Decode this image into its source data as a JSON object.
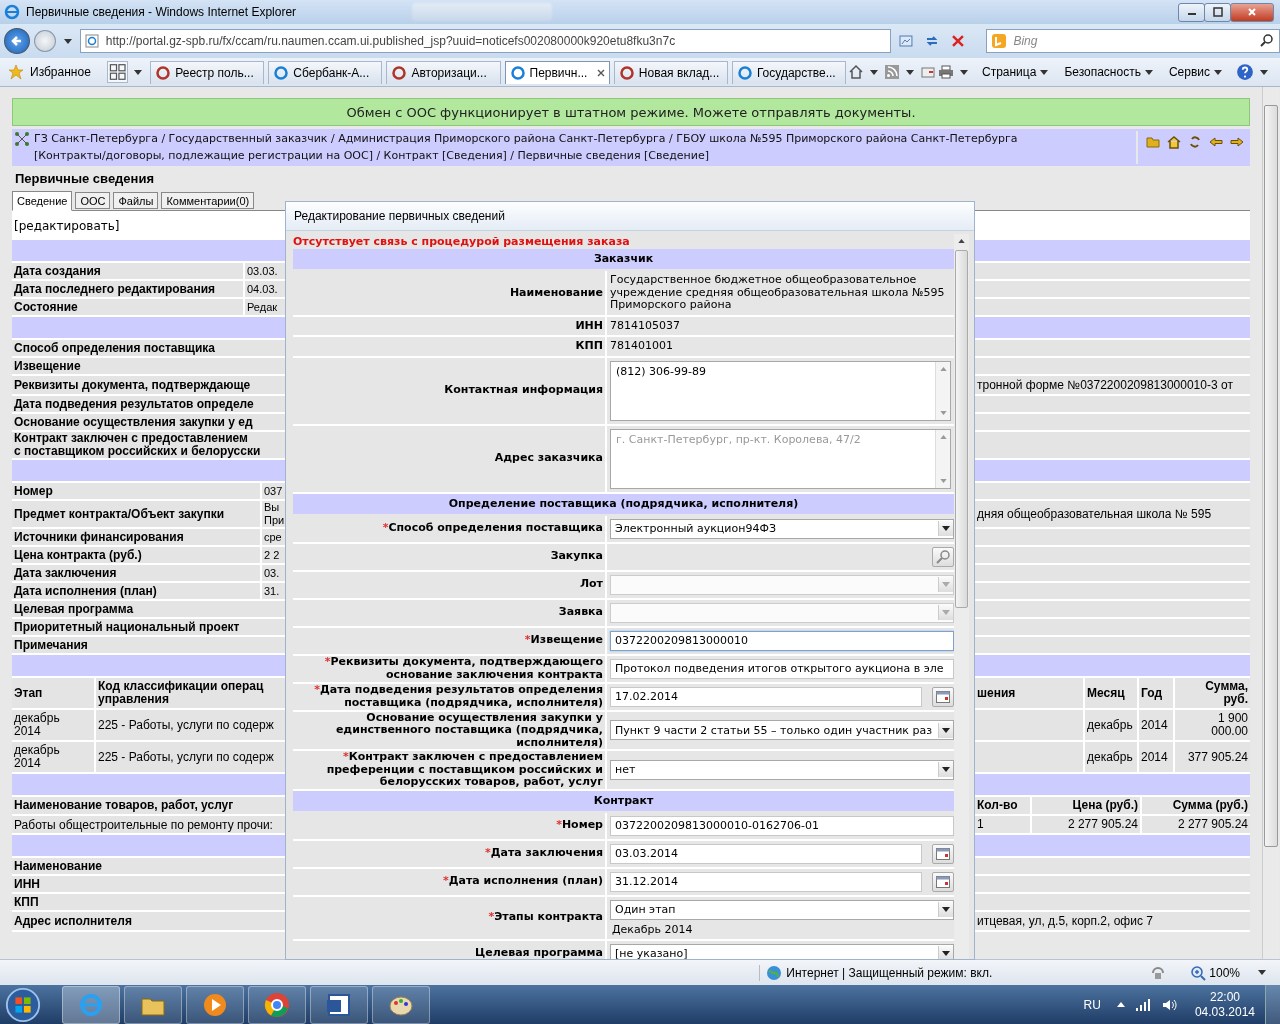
{
  "window": {
    "title": "Первичные сведения - Windows Internet Explorer"
  },
  "address_bar": {
    "url": "http://portal.gz-spb.ru/fx/ccam/ru.naumen.ccam.ui.published_jsp?uuid=noticefs002080000k920etu8fku3n7c",
    "search_placeholder": "Bing"
  },
  "favorites": {
    "label": "Избранное"
  },
  "browser_tabs": [
    {
      "label": "Реестр поль...",
      "selected": false
    },
    {
      "label": "Сбербанк-А...",
      "selected": false
    },
    {
      "label": "Авторизаци...",
      "selected": false
    },
    {
      "label": "Первичн...",
      "selected": true
    },
    {
      "label": "Новая вклад...",
      "selected": false
    },
    {
      "label": "Государстве...",
      "selected": false
    }
  ],
  "command_bar": [
    "Страница",
    "Безопасность",
    "Сервис"
  ],
  "page": {
    "banner": "Обмен с ООС функционирует в штатном режиме. Можете отправлять документы.",
    "breadcrumb": "ГЗ Санкт-Петербурга / Государственный заказчик / Администрация Приморского района Санкт-Петербурга / ГБОУ школа №595 Приморского района Санкт-Петербурга\n[Контракты/договоры, подлежащие регистрации на ООС] / Контракт [Сведения] / Первичные сведения [Сведение]",
    "title": "Первичные сведения",
    "tabs": [
      {
        "label": "Сведение",
        "selected": true
      },
      {
        "label": "ООС",
        "selected": false
      },
      {
        "label": "Файлы",
        "selected": false
      },
      {
        "label": "Комментарии(0)",
        "selected": false
      }
    ],
    "edit_link": "[редактировать]",
    "rows": [
      {
        "kind": "band"
      },
      {
        "kind": "field",
        "label": "Дата создания",
        "value": "03.03."
      },
      {
        "kind": "field",
        "label": "Дата последнего редактирования",
        "value": "04.03."
      },
      {
        "kind": "field",
        "label": "Состояние",
        "value": "Редак"
      },
      {
        "kind": "band"
      },
      {
        "kind": "field",
        "label": "Способ определения поставщика"
      },
      {
        "kind": "field",
        "label": "Извещение"
      },
      {
        "kind": "field",
        "label": "Реквизиты документа, подтверждающе",
        "right": "тронной форме №0372200209813000010-3 от"
      },
      {
        "kind": "field",
        "label": "Дата подведения результатов определе"
      },
      {
        "kind": "field",
        "label": "Основание осуществления закупки у ед"
      },
      {
        "kind": "field",
        "label": "Контракт заключен с предоставлением\nс поставщиком российских и белорусски"
      },
      {
        "kind": "band"
      },
      {
        "kind": "contract-field",
        "label": "Номер",
        "value": "037"
      },
      {
        "kind": "contract-field",
        "label": "Предмет контракта/Объект закупки",
        "value": "Вы\nПри",
        "right": "дняя общеобразовательная школа № 595"
      },
      {
        "kind": "contract-field",
        "label": "Источники финансирования",
        "value": "сре"
      },
      {
        "kind": "contract-field",
        "label": "Цена контракта (руб.)",
        "value": "2 2"
      },
      {
        "kind": "contract-field",
        "label": "Дата заключения",
        "value": "03."
      },
      {
        "kind": "contract-field",
        "label": "Дата исполнения (план)",
        "value": "31."
      },
      {
        "kind": "contract-field",
        "label": "Целевая программа"
      },
      {
        "kind": "contract-field",
        "label": "Приоритетный национальный проект"
      },
      {
        "kind": "contract-field",
        "label": "Примечания"
      },
      {
        "kind": "band"
      },
      {
        "kind": "stage-head",
        "stage": "Этап",
        "code": "Код классификации операц\nуправления",
        "tail": "шения",
        "month": "Месяц",
        "year": "Год",
        "sum": "Сумма,\nруб."
      },
      {
        "kind": "stage-row",
        "stage": "декабрь\n2014",
        "code": "225 - Работы, услуги по содерж",
        "month": "декабрь",
        "year": "2014",
        "sum": "1 900\n000.00"
      },
      {
        "kind": "stage-row",
        "stage": "декабрь\n2014",
        "code": "225 - Работы, услуги по содерж",
        "month": "декабрь",
        "year": "2014",
        "sum": "377 905.24"
      },
      {
        "kind": "band"
      },
      {
        "kind": "goods-head",
        "name": "Наименование товаров, работ, услуг",
        "qty": "Кол-во",
        "price": "Цена (руб.)",
        "sum": "Сумма (руб.)"
      },
      {
        "kind": "goods-row",
        "name": "Работы общестроительные по ремонту прочи:",
        "qty": "1",
        "price": "2 277 905.24",
        "sum": "2 277 905.24"
      },
      {
        "kind": "band"
      },
      {
        "kind": "field",
        "label": "Наименование"
      },
      {
        "kind": "field",
        "label": "ИНН"
      },
      {
        "kind": "field",
        "label": "КПП"
      },
      {
        "kind": "field",
        "label": "Адрес исполнителя",
        "right": "итцевая, ул, д.5, корп.2, офис 7"
      }
    ]
  },
  "dialog": {
    "title": "Редактирование первичных сведений",
    "error": "Отсутствует связь с процедурой размещения заказа",
    "rows": [
      {
        "kind": "section",
        "title": "Заказчик"
      },
      {
        "kind": "text",
        "label": "Наименование",
        "value": "Государственное бюджетное общеобразовательное\nучреждение средняя общеобразовательная школа №595\nПриморского района"
      },
      {
        "kind": "text",
        "label": "ИНН",
        "value": "7814105037"
      },
      {
        "kind": "text",
        "label": "КПП",
        "value": "781401001"
      },
      {
        "kind": "textarea",
        "label": "Контактная информация",
        "value": "(812) 306-99-89",
        "disabled": false
      },
      {
        "kind": "textarea",
        "label": "Адрес заказчика",
        "value": "г. Санкт-Петербург, пр-кт. Королева, 47/2",
        "disabled": true
      },
      {
        "kind": "section",
        "title": "Определение поставщика (подрядчика, исполнителя)"
      },
      {
        "kind": "select",
        "label": "Способ определения поставщика",
        "required_mark": "*",
        "value": "Электронный аукцион94ФЗ",
        "disabled": false
      },
      {
        "kind": "search",
        "label": "Закупка"
      },
      {
        "kind": "select",
        "label": "Лот",
        "disabled": true
      },
      {
        "kind": "select",
        "label": "Заявка",
        "disabled": true
      },
      {
        "kind": "input",
        "label": "Извещение",
        "required_mark": "*",
        "value": "0372200209813000010",
        "focused": true
      },
      {
        "kind": "input",
        "label": "Реквизиты документа, подтверждающего\nоснование заключения контракта",
        "required_mark": "*",
        "value": "Протокол подведения итогов открытого аукциона в эле",
        "focused": false
      },
      {
        "kind": "date",
        "label": "Дата подведения результатов определения\nпоставщика (подрядчика, исполнителя)",
        "required_mark": "*",
        "value": "17.02.2014"
      },
      {
        "kind": "select",
        "label": "Основание осуществления закупки у\nединственного поставщика (подрядчика,\nисполнителя)",
        "value": "Пункт 9 части 2 статьи 55 – только один участник раз",
        "disabled": false
      },
      {
        "kind": "select",
        "label": "Контракт заключен с предоставлением\nпреференции с поставщиком российских и\nбелорусских товаров, работ, услуг",
        "required_mark": "*",
        "value": "нет",
        "disabled": false
      },
      {
        "kind": "section",
        "title": "Контракт"
      },
      {
        "kind": "input",
        "label": "Номер",
        "required_mark": "*",
        "value": "0372200209813000010-0162706-01",
        "focused": false
      },
      {
        "kind": "date",
        "label": "Дата заключения",
        "required_mark": "*",
        "value": "03.03.2014"
      },
      {
        "kind": "date",
        "label": "Дата исполнения (план)",
        "required_mark": "*",
        "value": "31.12.2014"
      },
      {
        "kind": "select",
        "label": "Этапы контракта",
        "required_mark": "*",
        "value": "Один этап",
        "note": "Декабрь 2014",
        "disabled": false
      },
      {
        "kind": "select",
        "label": "Целевая программа",
        "value": "[не указано]",
        "disabled": false
      }
    ]
  },
  "status_bar": {
    "zone": "Интернет | Защищенный режим: вкл.",
    "zoom": "100%"
  },
  "taskbar": {
    "language": "RU",
    "time": "22:00",
    "date": "04.03.2014"
  }
}
